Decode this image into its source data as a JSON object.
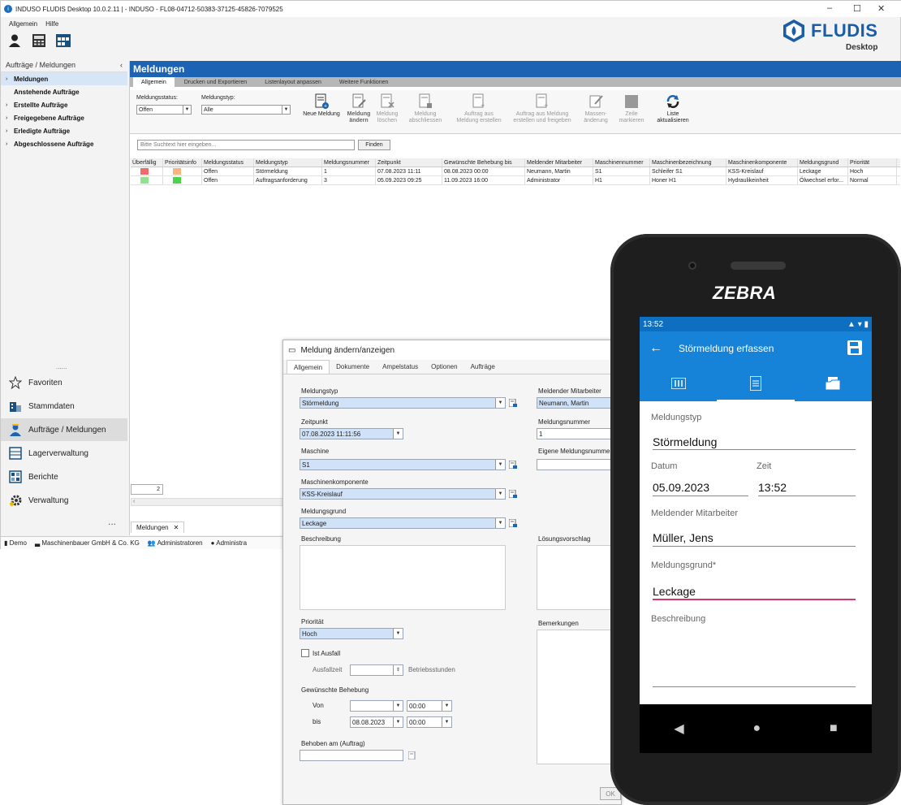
{
  "window": {
    "title": "INDUSO FLUDIS Desktop 10.0.2.11 | - INDUSO - FL08-04712-50383-37125-45826-7079525",
    "menu": [
      "Allgemein",
      "Hilfe"
    ],
    "logo": {
      "name": "FLUDIS",
      "sub": "Desktop"
    }
  },
  "sidebar": {
    "header": "Aufträge / Meldungen",
    "tree": [
      "Meldungen",
      "Anstehende Aufträge",
      "Erstellte Aufträge",
      "Freigegebene Aufträge",
      "Erledigte Aufträge",
      "Abgeschlossene Aufträge"
    ],
    "more": "......",
    "nav": [
      "Favoriten",
      "Stammdaten",
      "Aufträge / Meldungen",
      "Lagerverwaltung",
      "Berichte",
      "Verwaltung"
    ],
    "dots": "..."
  },
  "main": {
    "title": "Meldungen",
    "tabs": [
      "Allgemein",
      "Drucken und Exportieren",
      "Listenlayout anpassen",
      "Weitere Funktionen"
    ],
    "status_label": "Meldungsstatus:",
    "status_value": "Offen",
    "type_label": "Meldungstyp:",
    "type_value": "Alle",
    "buttons": {
      "neu": "Neue Meldung",
      "aendern1": "Meldung",
      "aendern2": "ändern",
      "loeschen1": "Meldung",
      "loeschen2": "löschen",
      "abschl1": "Meldung",
      "abschl2": "abschliessen",
      "auftrag1": "Auftrag aus",
      "auftrag2": "Meldung erstellen",
      "auftragf1": "Auftrag aus Meldung",
      "auftragf2": "erstellen und freigeben",
      "massen1": "Massen-",
      "massen2": "änderung",
      "zeile1": "Zeile",
      "zeile2": "markieren",
      "liste1": "Liste",
      "liste2": "aktualisieren"
    },
    "search_placeholder": "Bitte Suchtext hier eingeben...",
    "find": "Finden",
    "columns": [
      "Überfällig",
      "Prioritätsinfo",
      "Meldungsstatus",
      "Meldungstyp",
      "Meldungsnummer",
      "Zeitpunkt",
      "Gewünschte Behebung bis",
      "Meldender Mitarbeiter",
      "Maschinennummer",
      "Maschinenbezeichnung",
      "Maschinenkomponente",
      "Meldungsgrund",
      "Priorität"
    ],
    "rows": [
      {
        "c1": "#f06b6b",
        "c2": "#f7b47e",
        "status": "Offen",
        "typ": "Störmeldung",
        "nr": "1",
        "zeit": "07.08.2023 11:11",
        "bis": "08.08.2023 00:00",
        "mitarbeiter": "Neumann, Martin",
        "masch_nr": "S1",
        "masch_bez": "Schleifer S1",
        "komp": "KSS-Kreislauf",
        "grund": "Leckage",
        "prio": "Hoch"
      },
      {
        "c1": "#8fe38f",
        "c2": "#4bd34b",
        "status": "Offen",
        "typ": "Auftragsanforderung",
        "nr": "3",
        "zeit": "05.09.2023 09:25",
        "bis": "11.09.2023 16:00",
        "mitarbeiter": "Administrator",
        "masch_nr": "H1",
        "masch_bez": "Honer H1",
        "komp": "Hydraulikeinheit",
        "grund": "Ölwechsel erfor...",
        "prio": "Normal"
      }
    ],
    "pager": "2",
    "bottom_tab": "Meldungen",
    "status_items": [
      "Demo",
      "Maschinenbauer GmbH & Co. KG",
      "Administratoren",
      "Administra"
    ]
  },
  "dialog": {
    "title": "Meldung ändern/anzeigen",
    "tabs": [
      "Allgemein",
      "Dokumente",
      "Ampelstatus",
      "Optionen",
      "Aufträge"
    ],
    "meldungstyp_label": "Meldungstyp",
    "meldungstyp": "Störmeldung",
    "zeitpunkt_label": "Zeitpunkt",
    "zeitpunkt": "07.08.2023 11:11:56",
    "maschine_label": "Maschine",
    "maschine": "S1",
    "komp_label": "Maschinenkomponente",
    "komp": "KSS-Kreislauf",
    "grund_label": "Meldungsgrund",
    "grund": "Leckage",
    "beschreibung_label": "Beschreibung",
    "prio_label": "Priorität",
    "prio": "Hoch",
    "ausfall_label": "Ist Ausfall",
    "ausfallzeit_label": "Ausfallzeit",
    "betriebsstunden": "Betriebsstunden",
    "behebung_label": "Gewünschte Behebung",
    "von": "Von",
    "bis": "bis",
    "von_time": "00:00",
    "bis_date": "08.08.2023",
    "bis_time": "00:00",
    "behoben_label": "Behoben am (Auftrag)",
    "mitarbeiter_label": "Meldender Mitarbeiter",
    "mitarbeiter": "Neumann, Martin",
    "nr_label": "Meldungsnummer",
    "nr": "1",
    "eigene_label": "Eigene Meldungsnummer",
    "loesung_label": "Lösungsvorschlag",
    "bemerkungen_label": "Bemerkungen",
    "ok": "OK"
  },
  "phone": {
    "brand": "ZEBRA",
    "status_time": "13:52",
    "title": "Störmeldung erfassen",
    "typ_label": "Meldungstyp",
    "typ": "Störmeldung",
    "datum_label": "Datum",
    "datum": "05.09.2023",
    "zeit_label": "Zeit",
    "zeit": "13:52",
    "mitarbeiter_label": "Meldender Mitarbeiter",
    "mitarbeiter": "Müller, Jens",
    "grund_label": "Meldungsgrund*",
    "grund": "Leckage",
    "beschreibung_label": "Beschreibung"
  }
}
